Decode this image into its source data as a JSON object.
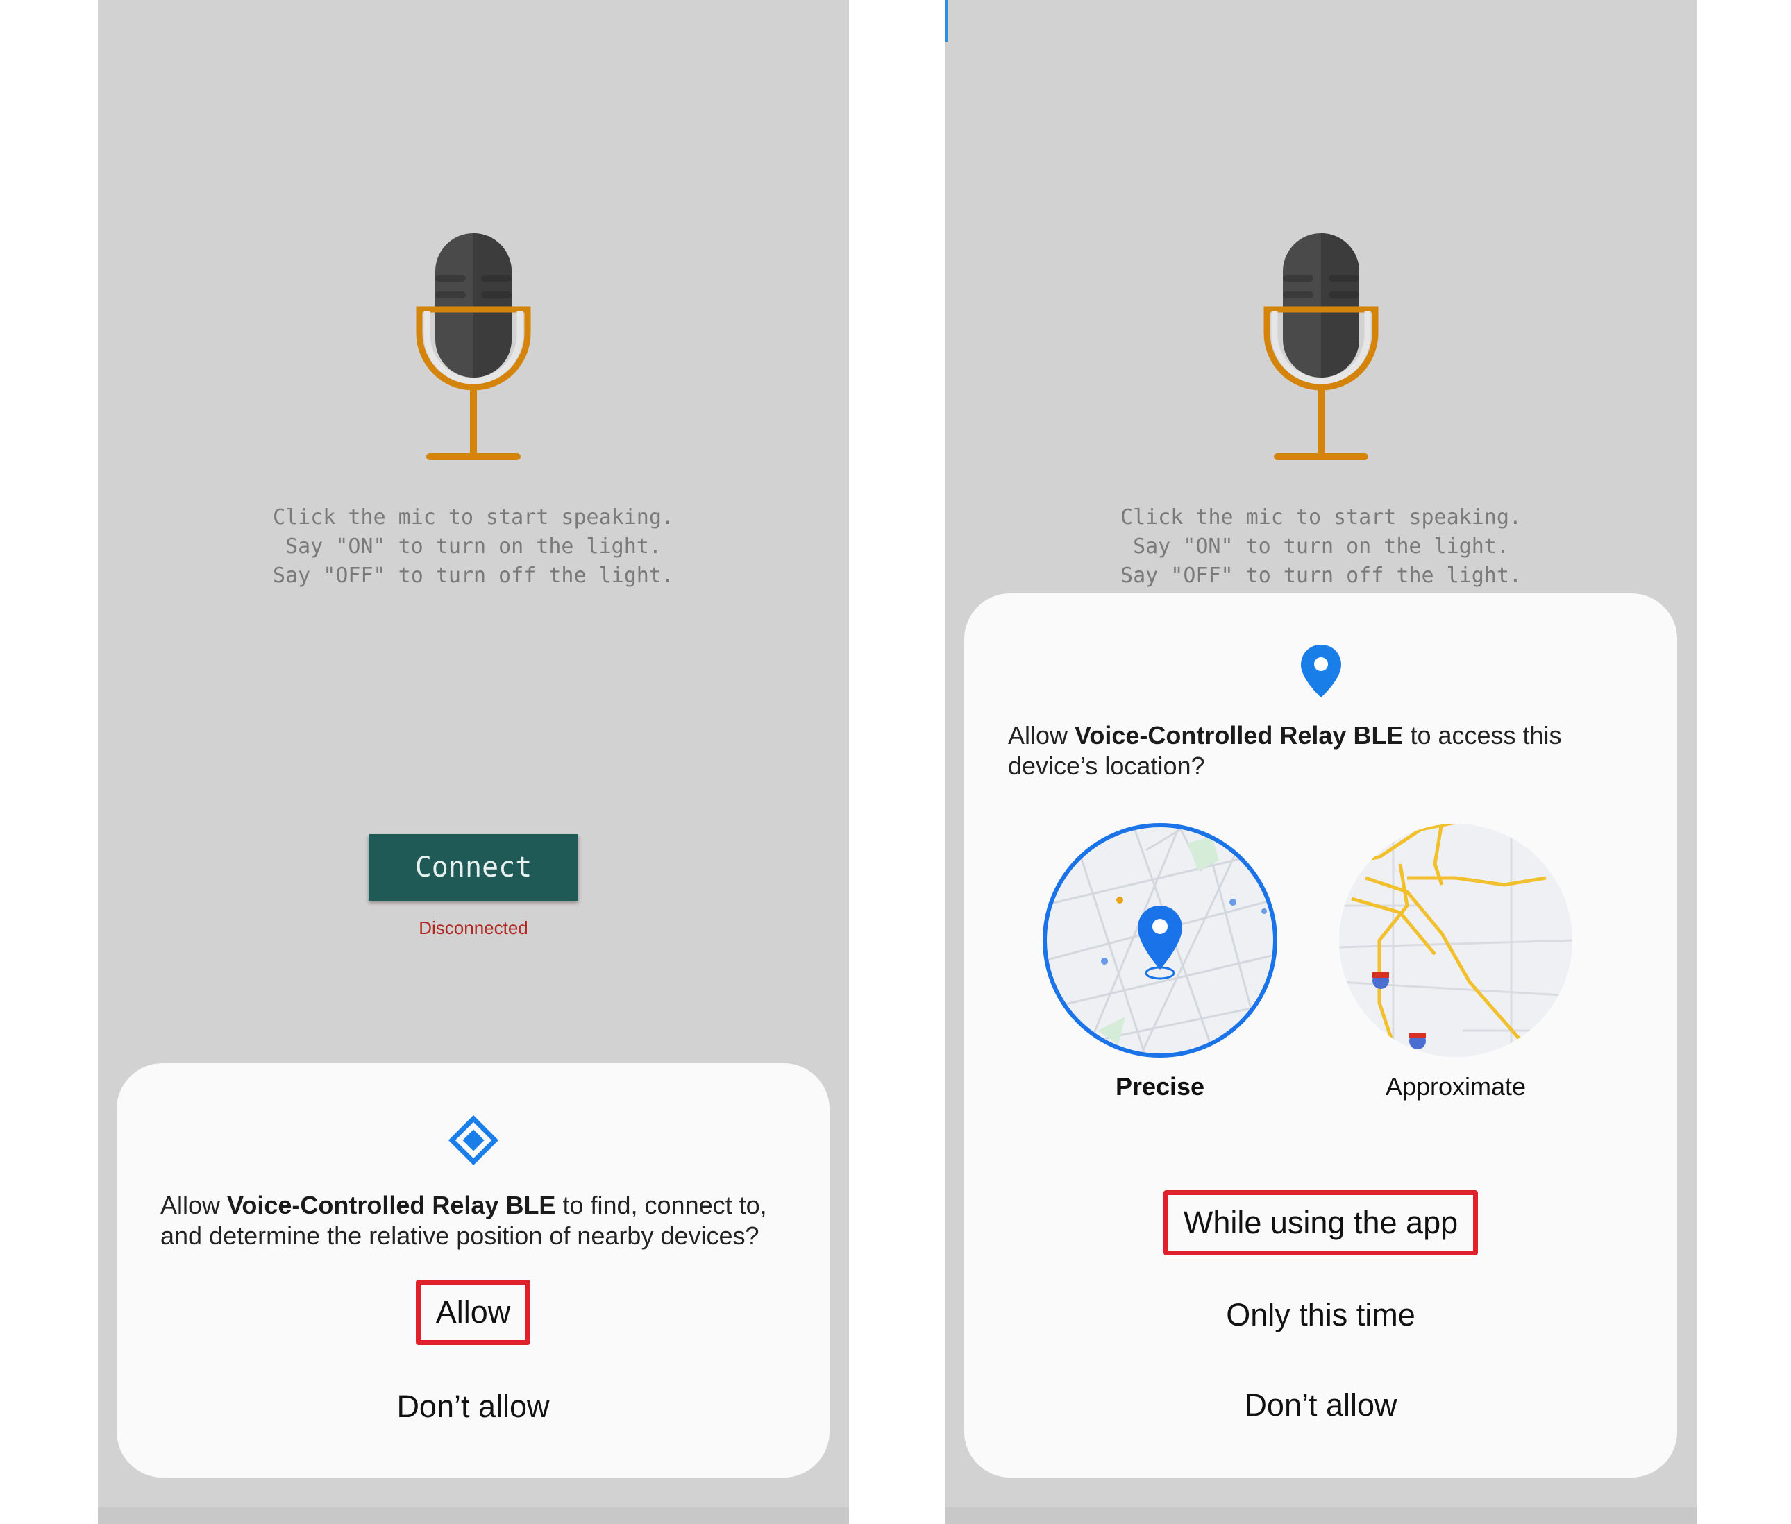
{
  "left_screen": {
    "instructions": [
      "Click the mic to start speaking.",
      "Say \"ON\" to turn on the light.",
      "Say \"OFF\" to turn off the light."
    ],
    "connect_label": "Connect",
    "status_text": "Disconnected",
    "status_color": "#b3261e",
    "dialog": {
      "icon": "nearby-devices-icon",
      "prefix": "Allow ",
      "app_name": "Voice-Controlled Relay BLE",
      "suffix": " to find, connect to, and determine the relative position of nearby devices?",
      "allow_label": "Allow",
      "deny_label": "Don’t allow"
    }
  },
  "right_screen": {
    "instructions": [
      "Click the mic to start speaking.",
      "Say \"ON\" to turn on the light.",
      "Say \"OFF\" to turn off the light."
    ],
    "dialog": {
      "icon": "location-pin-icon",
      "prefix": "Allow ",
      "app_name": "Voice-Controlled Relay BLE",
      "suffix": " to access this device’s location?",
      "precise_label": "Precise",
      "approximate_label": "Approximate",
      "while_using_label": "While using the app",
      "only_this_time_label": "Only this time",
      "deny_label": "Don’t allow"
    }
  },
  "colors": {
    "background": "#d2d2d2",
    "connect_button": "#1f5a57",
    "mic_stand": "#d4830b",
    "highlight_box": "#e0202a",
    "accent_blue": "#1a73e8"
  }
}
